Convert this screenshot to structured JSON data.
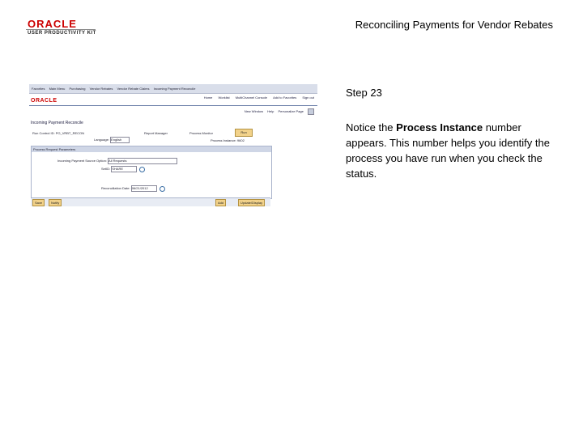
{
  "header": {
    "logo_top": "ORACLE",
    "logo_sub": "USER PRODUCTIVITY KIT",
    "title": "Reconciling Payments for Vendor Rebates"
  },
  "step": {
    "label": "Step 23"
  },
  "instruction": {
    "pre": "Notice the ",
    "bold": "Process Instance",
    "post": " number appears. This number helps you identify the process you have run when you check the status."
  },
  "screenshot": {
    "nav": [
      "Favorites",
      "Main Menu",
      "Purchasing",
      "Vendor Rebates",
      "Vendor Rebate Claims",
      "Incoming Payment Reconcile"
    ],
    "brand": "ORACLE",
    "top_links": [
      "Home",
      "Worklist",
      "MultiChannel Console",
      "Add to Favorites",
      "Sign out"
    ],
    "right_links": [
      "New Window",
      "Help",
      "Personalize Page"
    ],
    "component_title": "Incoming Payment Reconcile",
    "run_control_label": "Run Control ID:",
    "run_control_value": "PO_VRBT_RECON",
    "report_manager": "Report Manager",
    "process_monitor": "Process Monitor",
    "run_button": "Run",
    "language_label": "Language:",
    "language_value": "English",
    "process_instance": "Process Instance: 9602",
    "section_header": "Process Request Parameters",
    "field1_label": "Incoming Payment Source Option:",
    "field1_value": "All Requests",
    "field2_label": "SetID:",
    "field2_value": "SHARE",
    "field3_label": "Reconciliation Date:",
    "field3_value": "06/21/2012",
    "save_btn": "Save",
    "notify_btn": "Notify",
    "add_btn": "Add",
    "update_btn": "Update/Display"
  }
}
